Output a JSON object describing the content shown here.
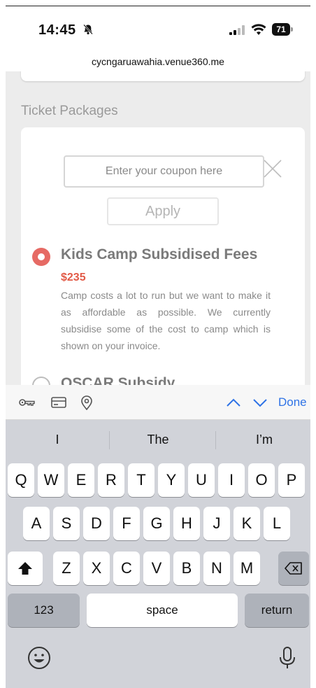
{
  "status_bar": {
    "time": "14:45",
    "battery": "71"
  },
  "browser": {
    "url": "cycngaruawahia.venue360.me"
  },
  "page": {
    "section_title": "Ticket Packages",
    "coupon": {
      "placeholder": "Enter your coupon here"
    },
    "apply_label": "Apply",
    "packages": [
      {
        "title": "Kids Camp Subsidised Fees",
        "price": "$235",
        "description": "Camp costs a lot to run but we want to make it as affordable as possible. We currently subsidise some of the cost to camp which is shown on your invoice.",
        "selected": true
      },
      {
        "title": "OSCAR Subsidy",
        "selected": false
      }
    ]
  },
  "accessory_bar": {
    "icons": [
      "key-icon",
      "credit-card-icon",
      "location-pin-icon"
    ],
    "done_label": "Done"
  },
  "keyboard": {
    "suggestions": [
      "I",
      "The",
      "I’m"
    ],
    "row1": [
      "Q",
      "W",
      "E",
      "R",
      "T",
      "Y",
      "U",
      "I",
      "O",
      "P"
    ],
    "row2": [
      "A",
      "S",
      "D",
      "F",
      "G",
      "H",
      "J",
      "K",
      "L"
    ],
    "row3": [
      "Z",
      "X",
      "C",
      "V",
      "B",
      "N",
      "M"
    ],
    "numbers_label": "123",
    "space_label": "space",
    "return_label": "return"
  },
  "colors": {
    "accent": "#e66a64",
    "price": "#e25a47",
    "link_blue": "#2f73e6"
  }
}
